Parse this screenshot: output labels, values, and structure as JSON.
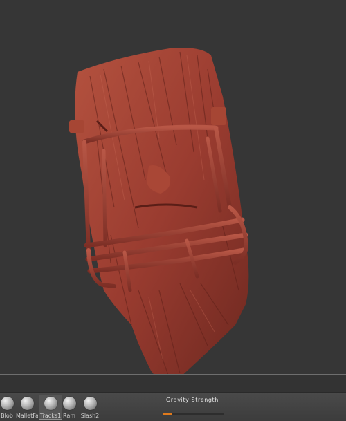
{
  "shelf": {
    "brushes": [
      {
        "label": "Blob",
        "selected": false
      },
      {
        "label": "MalletFa",
        "selected": false
      },
      {
        "label": "Tracks1",
        "selected": true
      },
      {
        "label": "Ram",
        "selected": false
      },
      {
        "label": "Slash2",
        "selected": false
      }
    ],
    "gravity": {
      "label": "Gravity Strength",
      "value_fraction": 0.15,
      "accent_color": "#e07a1c"
    }
  },
  "viewport": {
    "subject": "sculpted-head-with-football-facemask",
    "clay_color": "#9e3f32"
  }
}
